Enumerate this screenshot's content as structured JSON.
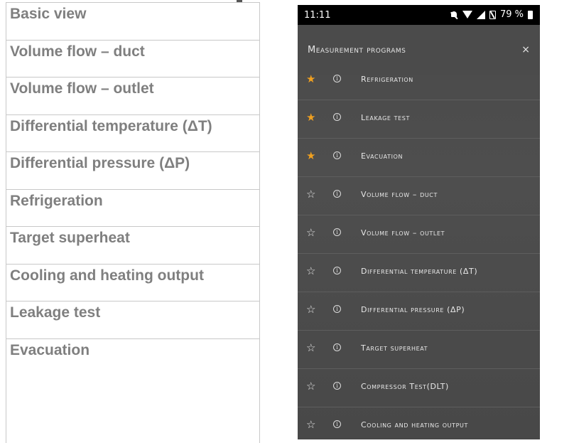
{
  "left_list": {
    "items": [
      "Basic view",
      "Volume flow – duct",
      "Volume flow – outlet",
      "Differential temperature (ΔT)",
      "Differential pressure (ΔP)",
      "Refrigeration",
      "Target superheat",
      "Cooling and heating output",
      "Leakage test",
      "Evacuation"
    ]
  },
  "phone": {
    "status_bar": {
      "time": "11:11",
      "battery": "79 %"
    },
    "header": {
      "title": "Measurement programs",
      "close": "×"
    },
    "programs": [
      {
        "label": "Refrigeration",
        "favorite": true
      },
      {
        "label": "Leakage test",
        "favorite": true
      },
      {
        "label": "Evacuation",
        "favorite": true
      },
      {
        "label": "Volume flow – duct",
        "favorite": false
      },
      {
        "label": "Volume flow – outlet",
        "favorite": false
      },
      {
        "label": "Differential temperature (ΔT)",
        "favorite": false
      },
      {
        "label": "Differential pressure (ΔP)",
        "favorite": false
      },
      {
        "label": "Target superheat",
        "favorite": false
      },
      {
        "label": "Compressor Test(DLT)",
        "favorite": false
      },
      {
        "label": "Cooling and heating output",
        "favorite": false
      }
    ],
    "star_filled": "★",
    "star_empty": "☆",
    "info_glyph": "i",
    "accent_color": "#f0a020"
  }
}
